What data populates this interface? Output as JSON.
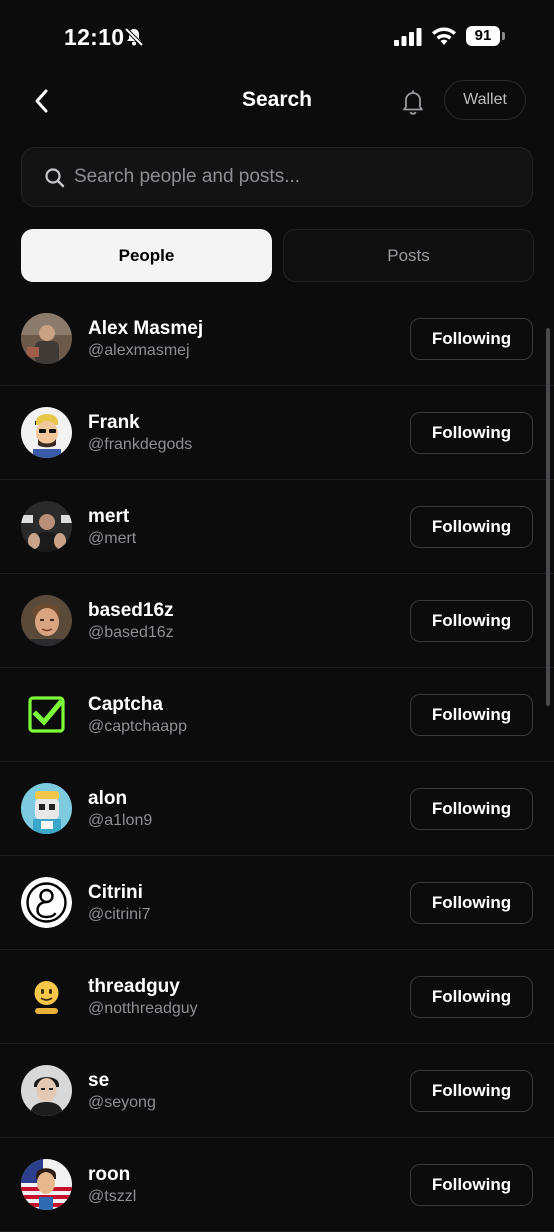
{
  "status_bar": {
    "time": "12:10",
    "battery": "91"
  },
  "header": {
    "title": "Search",
    "wallet_label": "Wallet"
  },
  "search": {
    "placeholder": "Search people and posts..."
  },
  "tabs": [
    {
      "label": "People",
      "selected": true
    },
    {
      "label": "Posts",
      "selected": false
    }
  ],
  "people": [
    {
      "name": "Alex Masmej",
      "handle": "@alexmasmej",
      "button": "Following"
    },
    {
      "name": "Frank",
      "handle": "@frankdegods",
      "button": "Following"
    },
    {
      "name": "mert",
      "handle": "@mert",
      "button": "Following"
    },
    {
      "name": "based16z",
      "handle": "@based16z",
      "button": "Following"
    },
    {
      "name": "Captcha",
      "handle": "@captchaapp",
      "button": "Following"
    },
    {
      "name": "alon",
      "handle": "@a1lon9",
      "button": "Following"
    },
    {
      "name": "Citrini",
      "handle": "@citrini7",
      "button": "Following"
    },
    {
      "name": "threadguy",
      "handle": "@notthreadguy",
      "button": "Following"
    },
    {
      "name": "se",
      "handle": "@seyong",
      "button": "Following"
    },
    {
      "name": "roon",
      "handle": "@tszzl",
      "button": "Following"
    }
  ],
  "colors": {
    "background": "#0c0c0d",
    "accent_green": "#7dfc3a"
  }
}
